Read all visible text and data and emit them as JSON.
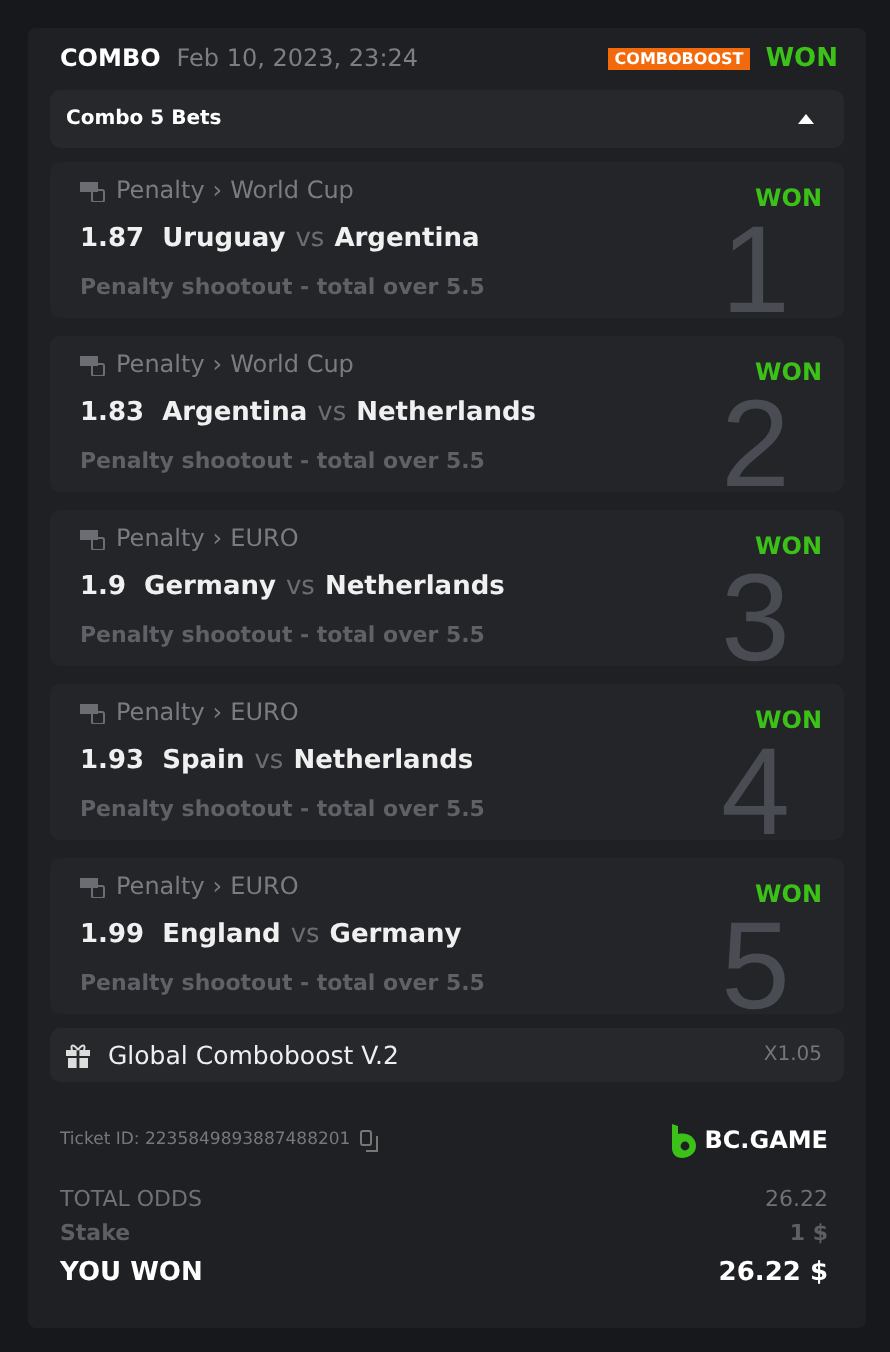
{
  "ticket": {
    "type": "COMBO",
    "date": "Feb 10, 2023, 23:24",
    "badge": "COMBOBOOST",
    "status": "WON"
  },
  "combo_bar": {
    "label": "Combo 5 Bets",
    "expanded": true
  },
  "bets": [
    {
      "sport": "Penalty",
      "separator": "›",
      "league": "World Cup",
      "status": "WON",
      "odds": "1.87",
      "home": "Uruguay",
      "vs": "vs",
      "away": "Argentina",
      "market": "Penalty shootout - total over 5.5",
      "number": "1"
    },
    {
      "sport": "Penalty",
      "separator": "›",
      "league": "World Cup",
      "status": "WON",
      "odds": "1.83",
      "home": "Argentina",
      "vs": "vs",
      "away": "Netherlands",
      "market": "Penalty shootout - total over 5.5",
      "number": "2"
    },
    {
      "sport": "Penalty",
      "separator": "›",
      "league": "EURO",
      "status": "WON",
      "odds": "1.9",
      "home": "Germany",
      "vs": "vs",
      "away": "Netherlands",
      "market": "Penalty shootout - total over 5.5",
      "number": "3"
    },
    {
      "sport": "Penalty",
      "separator": "›",
      "league": "EURO",
      "status": "WON",
      "odds": "1.93",
      "home": "Spain",
      "vs": "vs",
      "away": "Netherlands",
      "market": "Penalty shootout - total over 5.5",
      "number": "4"
    },
    {
      "sport": "Penalty",
      "separator": "›",
      "league": "EURO",
      "status": "WON",
      "odds": "1.99",
      "home": "England",
      "vs": "vs",
      "away": "Germany",
      "market": "Penalty shootout - total over 5.5",
      "number": "5"
    }
  ],
  "boost": {
    "label": "Global Comboboost V.2",
    "multiplier": "X1.05"
  },
  "ticket_id": "Ticket ID: 2235849893887488201",
  "brand": "BC.GAME",
  "totals": [
    {
      "kind": "odds",
      "label": "TOTAL ODDS",
      "value": "26.22"
    },
    {
      "kind": "stake",
      "label": "Stake",
      "value": "1 $"
    },
    {
      "kind": "won",
      "label": "YOU WON",
      "value": "26.22 $"
    }
  ]
}
